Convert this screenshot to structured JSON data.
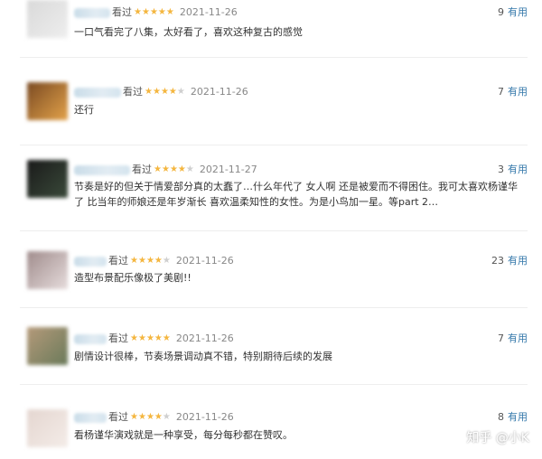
{
  "reviews": [
    {
      "watched": "看过",
      "stars": 5,
      "date": "2021-11-26",
      "count": "9",
      "useful": "有用",
      "content": "一口气看完了八集，太好看了，喜欢这种复古的感觉",
      "avatar_colors": [
        "#d9d9d9",
        "#eeeeee"
      ]
    },
    {
      "watched": "看过",
      "stars": 4,
      "date": "2021-11-26",
      "count": "7",
      "useful": "有用",
      "content": "还行",
      "avatar_colors": [
        "#7a4a22",
        "#e3a24a"
      ]
    },
    {
      "watched": "看过",
      "stars": 4,
      "date": "2021-11-27",
      "count": "3",
      "useful": "有用",
      "content": "节奏是好的但关于情爱部分真的太蠢了…什么年代了 女人啊 还是被爱而不得困住。我可太喜欢杨谨华了 比当年的师娘还是年岁渐长 喜欢温柔知性的女性。为是小鸟加一星。等part 2…",
      "avatar_colors": [
        "#1a1a1a",
        "#3a4a3a"
      ]
    },
    {
      "watched": "看过",
      "stars": 4,
      "date": "2021-11-26",
      "count": "23",
      "useful": "有用",
      "content": "造型布景配乐像极了美剧!!",
      "avatar_colors": [
        "#a08c8c",
        "#e6dcdc"
      ]
    },
    {
      "watched": "看过",
      "stars": 5,
      "date": "2021-11-26",
      "count": "7",
      "useful": "有用",
      "content": "剧情设计很棒，节奏场景调动真不错，特别期待后续的发展",
      "avatar_colors": [
        "#b59a7a",
        "#6a7a5a"
      ]
    },
    {
      "watched": "看过",
      "stars": 4,
      "date": "2021-11-26",
      "count": "8",
      "useful": "有用",
      "content": "看杨谨华演戏就是一种享受，每分每秒都在赞叹。",
      "avatar_colors": [
        "#e4d6d0",
        "#f4ece8"
      ]
    }
  ],
  "watermark": "知乎 @小K"
}
